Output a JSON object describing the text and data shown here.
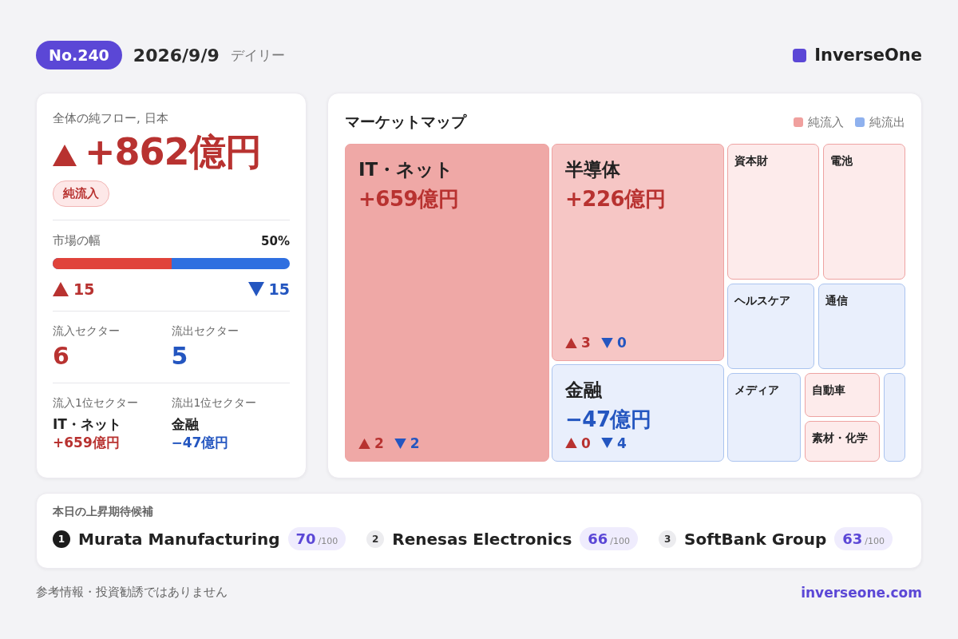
{
  "header": {
    "issue": "No.240",
    "date": "2026/9/9",
    "period": "デイリー",
    "brand": "InverseOne"
  },
  "summary": {
    "title": "全体の純フロー, 日本",
    "rising": true,
    "amount": "+862億円",
    "badge": "純流入",
    "breadth": {
      "label": "市場の幅",
      "percent": "50%",
      "level": 0.5,
      "up": "15",
      "down": "15"
    },
    "counts": [
      {
        "label": "流入セクター",
        "value": "6",
        "inflow": true
      },
      {
        "label": "流出セクター",
        "value": "5",
        "inflow": false
      }
    ],
    "tops": [
      {
        "label": "流入1位セクター",
        "name": "IT・ネット",
        "value": "+659億円",
        "inflow": true
      },
      {
        "label": "流出1位セクター",
        "name": "金融",
        "value": "−47億円",
        "inflow": false
      }
    ]
  },
  "market_map": {
    "title": "マーケットマップ",
    "legend": [
      {
        "label": "純流入",
        "color": "#f0a09e"
      },
      {
        "label": "純流出",
        "color": "#8fb1ee"
      }
    ],
    "tiles": [
      {
        "name": "IT・ネット",
        "value": "+659億円",
        "inflow": true,
        "dark": true,
        "mid": false,
        "up": "2",
        "down": "2"
      },
      {
        "name": "半導体",
        "value": "+226億円",
        "inflow": true,
        "dark": false,
        "mid": true,
        "up": "3",
        "down": "0"
      },
      {
        "name": "金融",
        "value": "−47億円",
        "inflow": false,
        "dark": false,
        "mid": false,
        "up": "0",
        "down": "4"
      },
      {
        "name": "資本財",
        "inflow": true,
        "dark": false,
        "mid": false
      },
      {
        "name": "電池",
        "inflow": true,
        "dark": false,
        "mid": false
      },
      {
        "name": "ヘルスケア",
        "inflow": false,
        "dark": false,
        "mid": false
      },
      {
        "name": "通信",
        "inflow": false,
        "dark": false,
        "mid": false
      },
      {
        "name": "メディア",
        "inflow": false,
        "dark": false,
        "mid": false
      },
      {
        "name": "自動車",
        "inflow": true,
        "dark": false,
        "mid": false
      },
      {
        "name": "素材・化学",
        "inflow": true,
        "dark": false,
        "mid": false
      },
      {
        "inflow": false,
        "dark": false,
        "mid": false
      }
    ]
  },
  "candidates": {
    "title": "本日の上昇期待候補",
    "items": [
      {
        "rank": "1",
        "top": true,
        "name": "Murata Manufacturing",
        "score": "70",
        "max": "/100"
      },
      {
        "rank": "2",
        "top": false,
        "name": "Renesas Electronics",
        "score": "66",
        "max": "/100"
      },
      {
        "rank": "3",
        "top": false,
        "name": "SoftBank Group",
        "score": "63",
        "max": "/100"
      }
    ]
  },
  "footer": {
    "disclaimer": "参考情報・投資勧誘ではありません",
    "site": "inverseone.com"
  }
}
